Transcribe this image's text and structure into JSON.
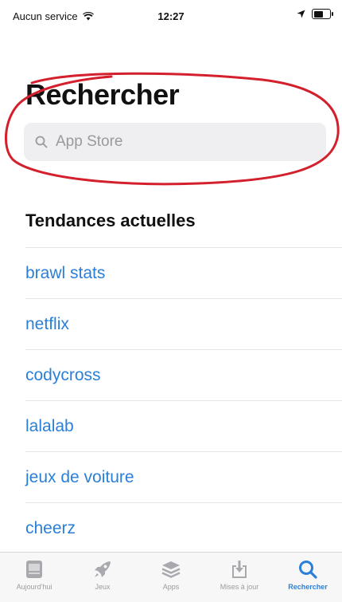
{
  "status_bar": {
    "carrier": "Aucun service",
    "time": "12:27",
    "battery_level": 0.7,
    "icons": [
      "wifi-icon",
      "location-arrow-icon",
      "battery-icon"
    ]
  },
  "page": {
    "title": "Rechercher"
  },
  "search": {
    "placeholder": "App Store",
    "icon": "search-icon"
  },
  "trending": {
    "heading": "Tendances actuelles",
    "items": [
      "brawl stats",
      "netflix",
      "codycross",
      "lalalab",
      "jeux de voiture",
      "cheerz"
    ]
  },
  "tabbar": {
    "tabs": [
      {
        "label": "Aujourd'hui",
        "icon": "today-icon",
        "active": false
      },
      {
        "label": "Jeux",
        "icon": "rocket-icon",
        "active": false
      },
      {
        "label": "Apps",
        "icon": "apps-stack-icon",
        "active": false
      },
      {
        "label": "Mises à jour",
        "icon": "updates-icon",
        "active": false
      },
      {
        "label": "Rechercher",
        "icon": "search-icon",
        "active": true
      }
    ]
  },
  "colors": {
    "accent": "#2a7fd8",
    "annotation": "#d4202c"
  }
}
